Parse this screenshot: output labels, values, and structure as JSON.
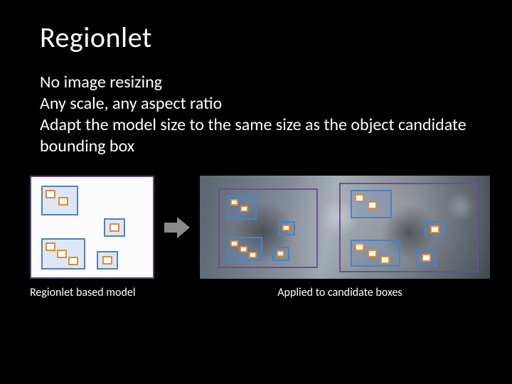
{
  "title": "Regionlet",
  "body": {
    "line1": "No image resizing",
    "line2": "Any scale, any aspect ratio",
    "line3": "Adapt the model size to the same size as the object candidate bounding box"
  },
  "captions": {
    "left": "Regionlet based model",
    "right": "Applied to candidate boxes"
  }
}
